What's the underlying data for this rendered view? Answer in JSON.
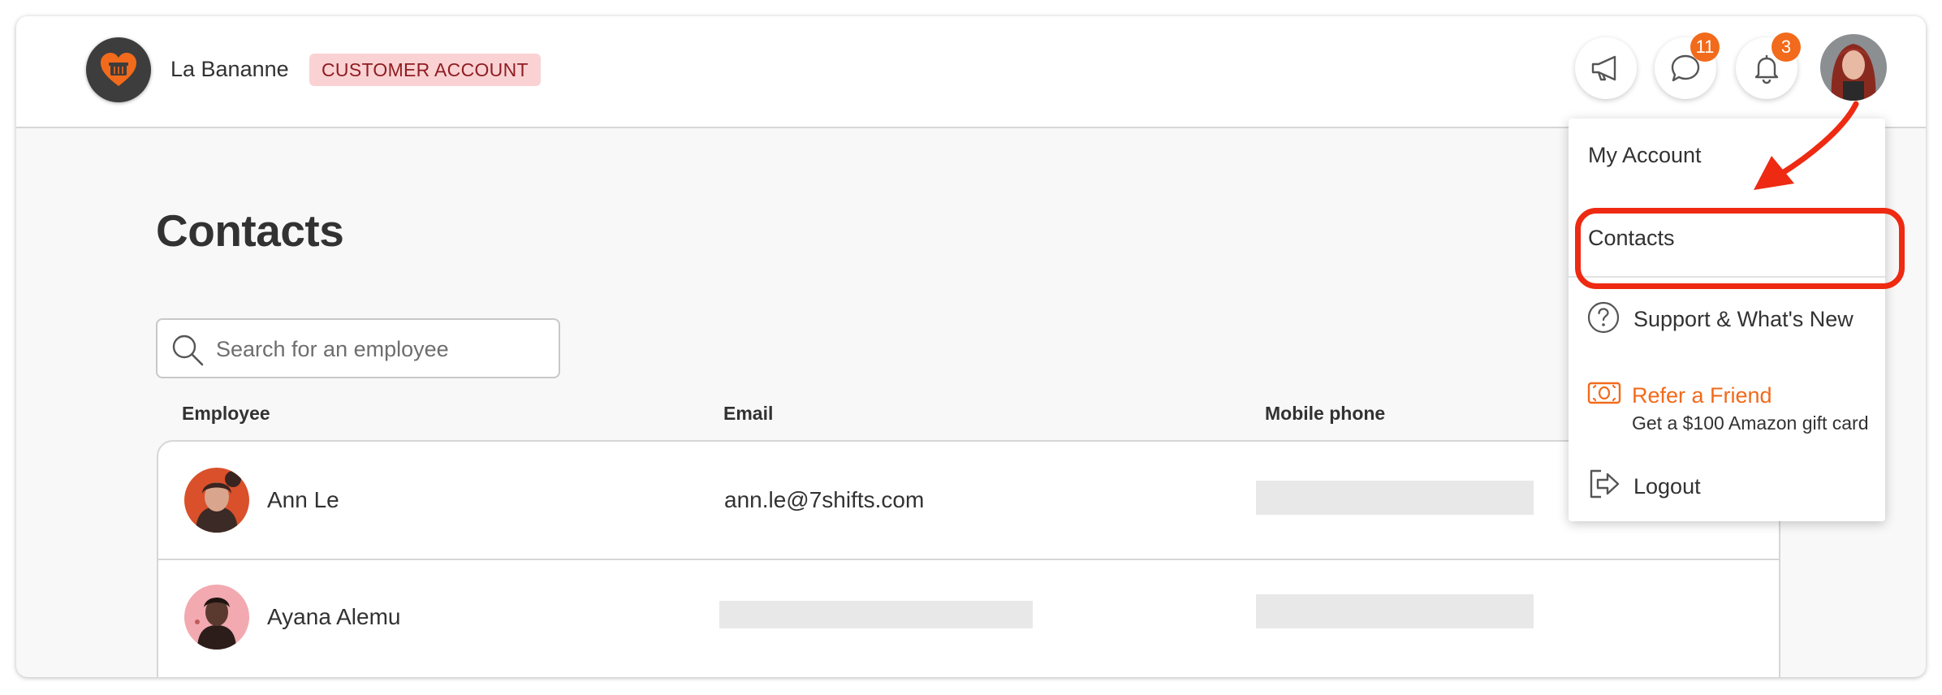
{
  "header": {
    "brand_name": "La Bananne",
    "account_badge": "CUSTOMER ACCOUNT",
    "messages_count": "11",
    "notifications_count": "3"
  },
  "page": {
    "title": "Contacts"
  },
  "search": {
    "placeholder": "Search for an employee",
    "value": ""
  },
  "table": {
    "columns": [
      "Employee",
      "Email",
      "Mobile phone"
    ],
    "rows": [
      {
        "name": "Ann Le",
        "email": "ann.le@7shifts.com",
        "phone": ""
      },
      {
        "name": "Ayana Alemu",
        "email": "",
        "phone": ""
      }
    ]
  },
  "menu": {
    "items": [
      {
        "label": "My Account"
      },
      {
        "label": "Contacts"
      },
      {
        "label": "Support & What's New"
      },
      {
        "label": "Refer a Friend",
        "sublabel": "Get a $100 Amazon gift card"
      },
      {
        "label": "Logout"
      }
    ]
  },
  "icons": {
    "brand": "heart-basket-logo-icon",
    "announcements": "megaphone-icon",
    "messages": "chat-bubble-icon",
    "notifications": "bell-icon",
    "search": "search-icon",
    "support": "question-circle-icon",
    "refer": "banknote-icon",
    "logout": "logout-icon"
  },
  "colors": {
    "accent": "#f26a1b",
    "badge_bg": "#fad2d3",
    "badge_text": "#8f1d22",
    "annotation": "#ee2a12"
  }
}
